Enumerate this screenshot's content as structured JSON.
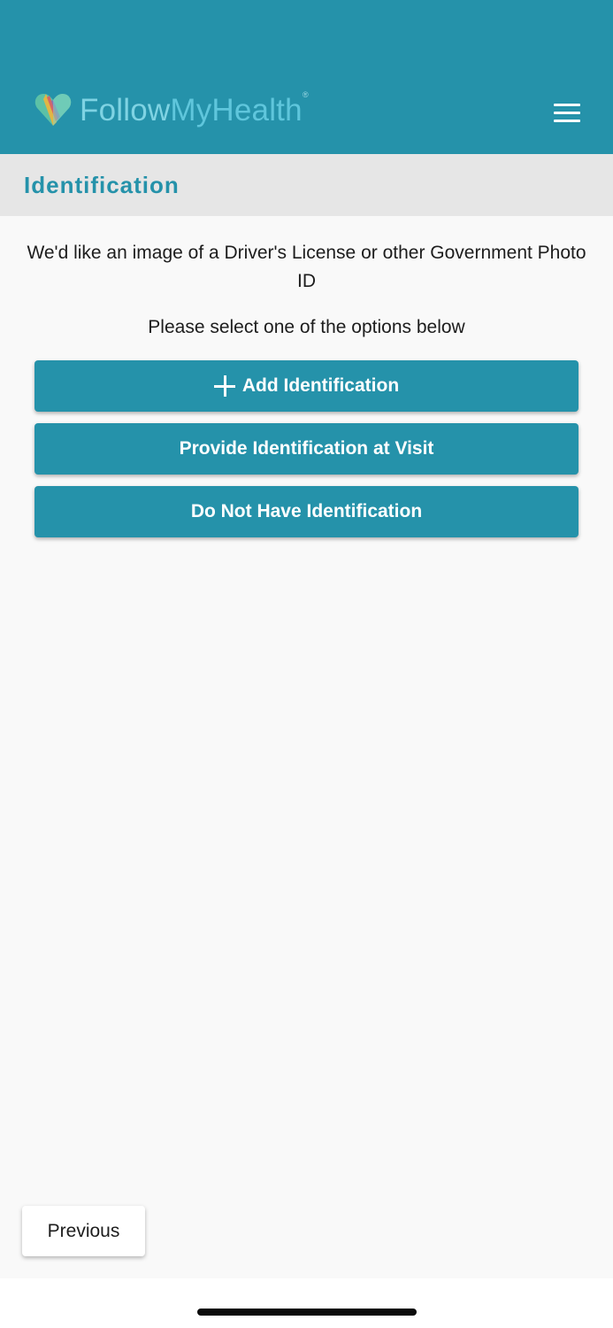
{
  "header": {
    "logo_part_a": "Follow",
    "logo_part_b": "MyHealth",
    "logo_registered": "®"
  },
  "page": {
    "title": "Identification",
    "intro_text": "We'd like an image of a Driver's License or other Government Photo ID",
    "instruction_text": "Please select one of the options below"
  },
  "actions": {
    "add_label": "Add Identification",
    "visit_label": "Provide Identification at Visit",
    "none_label": "Do Not Have Identification"
  },
  "footer": {
    "previous_label": "Previous"
  },
  "icons": {
    "logo": "heart-logo-icon",
    "menu": "hamburger-menu-icon",
    "add": "plus-icon"
  },
  "colors": {
    "brand": "#2592aa",
    "subheader_bg": "#e6e6e6",
    "content_bg": "#f9f9f9",
    "text": "#1d1d1d"
  }
}
